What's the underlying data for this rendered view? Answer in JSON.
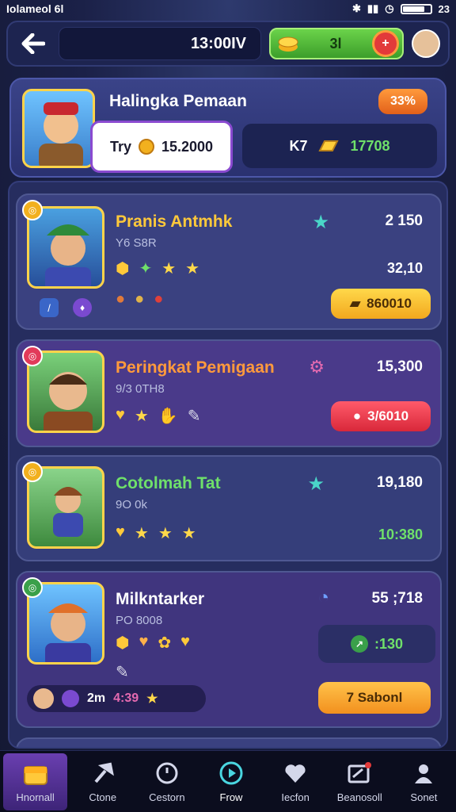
{
  "status": {
    "carrier": "Iolameol 6l",
    "time": "23"
  },
  "topbar": {
    "timer": "13:00IV",
    "coins": "3l",
    "add_label": "+"
  },
  "header": {
    "title": "Halingka Pemaan",
    "percent": "33%",
    "try_label": "Try",
    "try_value": "15.2000",
    "kx_label": "K7",
    "kx_value": "17708"
  },
  "players": [
    {
      "name": "Pranis Antmhk",
      "sub": "Y6 S8R",
      "score": "2 150",
      "sub2": "32,10",
      "button": "860010",
      "color_bg": "#3a4180",
      "name_color": "#ffc93a"
    },
    {
      "name": "Peringkat Pemigaan",
      "sub": "9/3 0TH8",
      "score": "15,300",
      "button": "3/6010",
      "color_bg": "#4a3a8a",
      "name_color": "#ff9a3c"
    },
    {
      "name": "Cotolmah Tat",
      "sub": "9O 0k",
      "score": "19,180",
      "sub2": "10:380",
      "color_bg": "#353e7a",
      "name_color": "#6fe06a"
    },
    {
      "name": "Milkntarker",
      "sub": "PO 8008",
      "score": "55 ;718",
      "sub2": ":130",
      "team_label": "2m",
      "team_value": "4:39",
      "button": "7 Sabonl",
      "color_bg": "#40357e",
      "name_color": "#ffffff"
    }
  ],
  "nav": [
    {
      "label": "Hnornall",
      "icon": "chest-icon"
    },
    {
      "label": "Ctone",
      "icon": "hammer-icon"
    },
    {
      "label": "Cestorn",
      "icon": "compass-icon"
    },
    {
      "label": "Frow",
      "icon": "play-icon"
    },
    {
      "label": "Iecfon",
      "icon": "heart-icon"
    },
    {
      "label": "Beanosoll",
      "icon": "mail-icon"
    },
    {
      "label": "Sonet",
      "icon": "profile-icon"
    }
  ]
}
